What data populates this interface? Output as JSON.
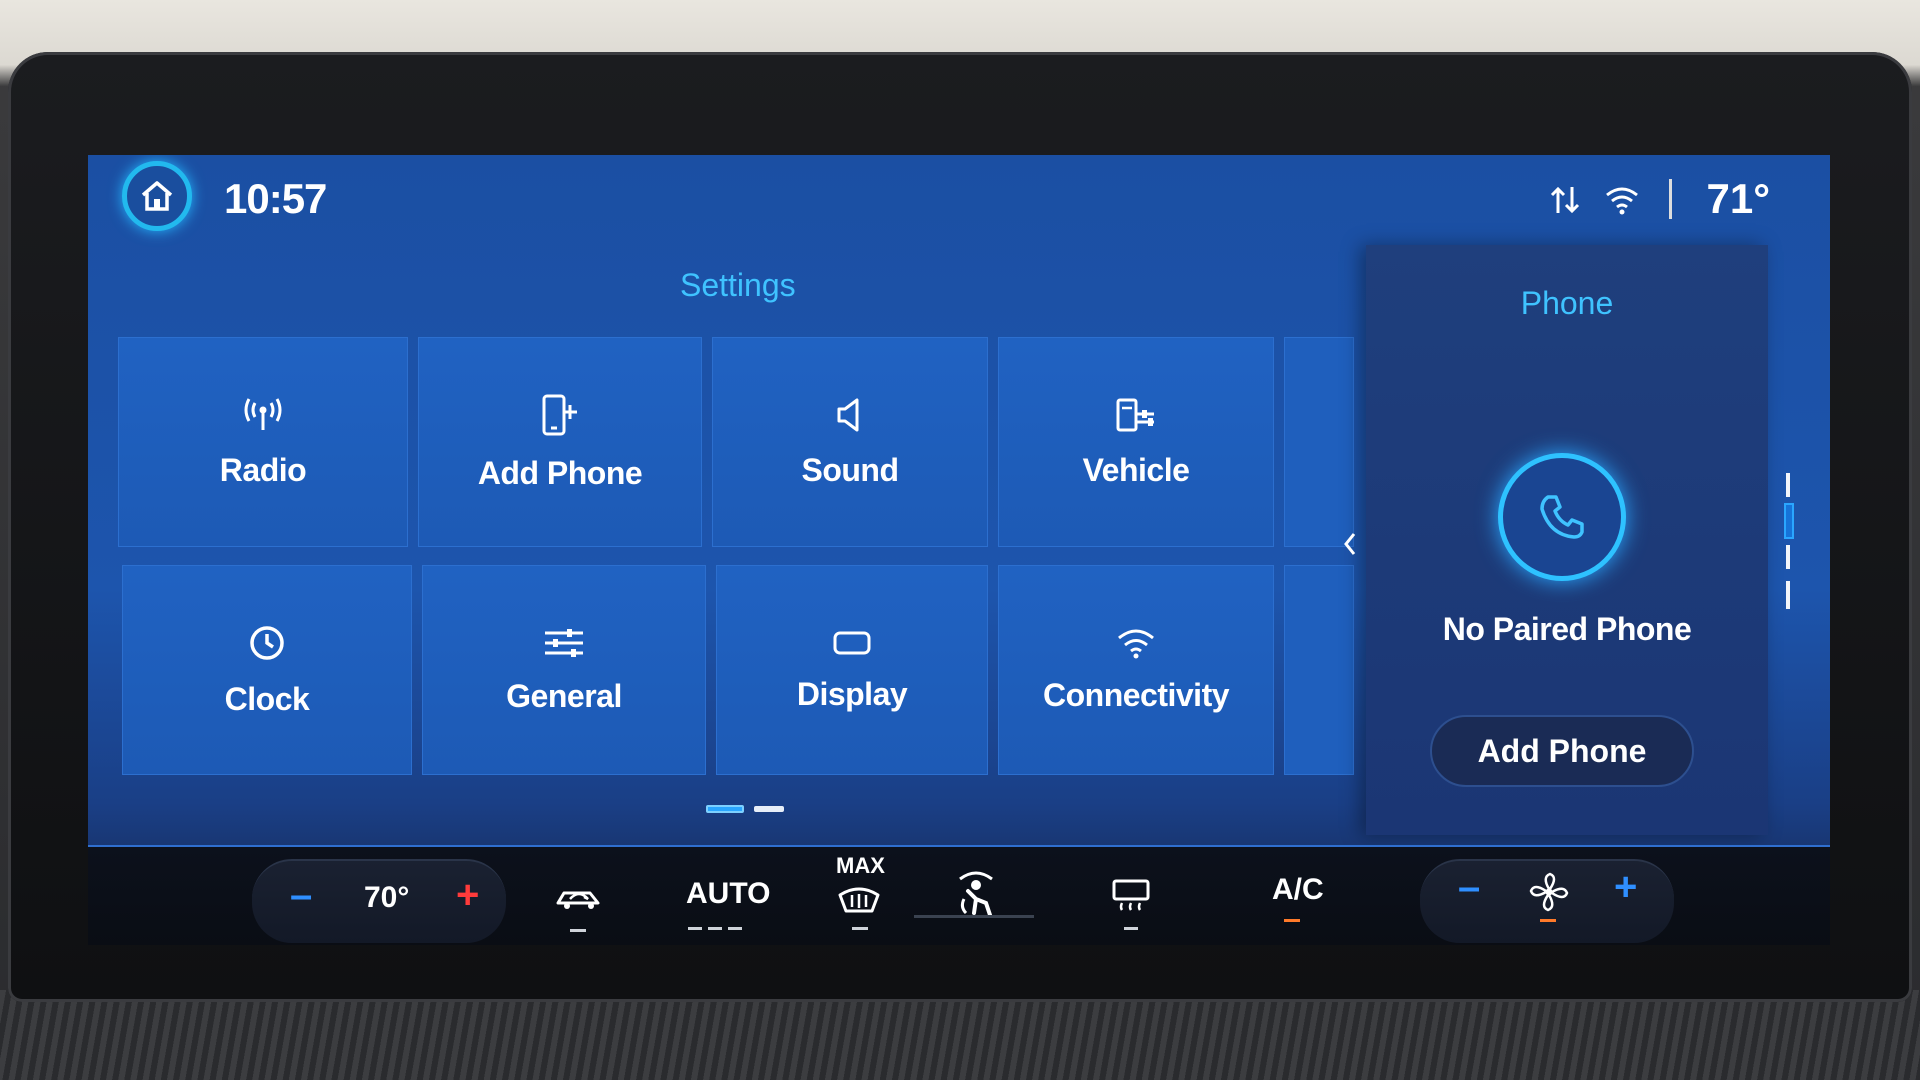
{
  "topbar": {
    "time": "10:57",
    "outside_temp": "71°",
    "icons": [
      "home-icon",
      "signal-arrows-icon",
      "wifi-icon"
    ]
  },
  "settings": {
    "title": "Settings",
    "tiles": [
      {
        "label": "Radio",
        "icon": "radio-antenna-icon"
      },
      {
        "label": "Add Phone",
        "icon": "add-phone-icon"
      },
      {
        "label": "Sound",
        "icon": "speaker-icon"
      },
      {
        "label": "Vehicle",
        "icon": "vehicle-settings-icon"
      },
      {
        "label": "Clock",
        "icon": "clock-icon"
      },
      {
        "label": "General",
        "icon": "sliders-icon"
      },
      {
        "label": "Display",
        "icon": "display-icon"
      },
      {
        "label": "Connectivity",
        "icon": "wifi-icon"
      }
    ],
    "pager": {
      "pages": 2,
      "current": 1
    }
  },
  "phone_panel": {
    "title": "Phone",
    "status": "No Paired Phone",
    "button_label": "Add Phone"
  },
  "climate": {
    "driver_temp": "70°",
    "auto_label": "AUTO",
    "max_label": "MAX",
    "ac_label": "A/C",
    "minus": "–",
    "plus": "+",
    "colors": {
      "accent_blue": "#2f8fff",
      "heat_red": "#ff3b3b",
      "active_orange": "#ff7a2a"
    }
  }
}
